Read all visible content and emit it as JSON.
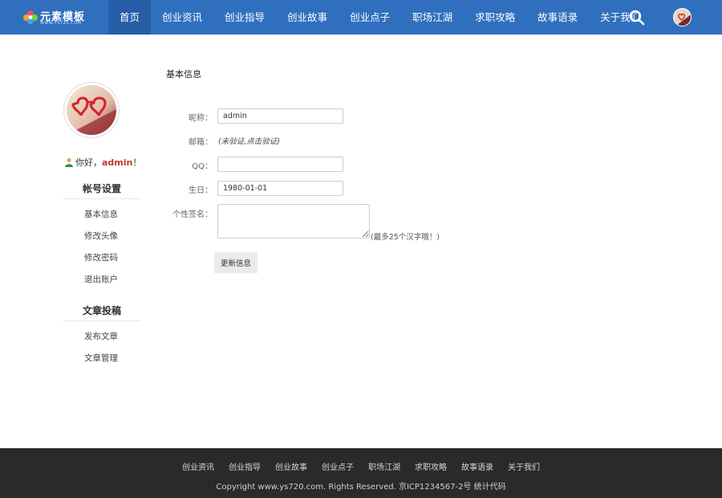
{
  "brand": {
    "name": "元素模板",
    "domain": "WWW.YS720.COM"
  },
  "nav": {
    "items": [
      "首页",
      "创业资讯",
      "创业指导",
      "创业故事",
      "创业点子",
      "职场江湖",
      "求职攻略",
      "故事语录",
      "关于我们"
    ],
    "active": 0
  },
  "sidebar": {
    "greeting_prefix": "你好，",
    "username": "admin",
    "greeting_suffix": "！",
    "account_title": "帐号设置",
    "account_items": [
      "基本信息",
      "修改头像",
      "修改密码",
      "退出账户"
    ],
    "posts_title": "文章投稿",
    "posts_items": [
      "发布文章",
      "文章管理"
    ]
  },
  "form": {
    "title": "基本信息",
    "nickname_label": "昵称：",
    "nickname_value": "admin",
    "email_label": "邮箱：",
    "email_note": "(未验证,点击验证)",
    "qq_label": "QQ：",
    "qq_value": "",
    "birthday_label": "生日：",
    "birthday_value": "1980-01-01",
    "signature_label": "个性签名：",
    "signature_hint": "(最多25个汉字哦！)",
    "submit_label": "更新信息"
  },
  "footer": {
    "links": [
      "创业资讯",
      "创业指导",
      "创业故事",
      "创业点子",
      "职场江湖",
      "求职攻略",
      "故事语录",
      "关于我们"
    ],
    "copyright": "Copyright www.ys720.com. Rights Reserved. 京ICP1234567-2号 统计代码"
  },
  "colors": {
    "header": "#2f6fbe",
    "nav_active": "#255ea6",
    "footer": "#2a2a2a",
    "username": "#c0392b"
  }
}
